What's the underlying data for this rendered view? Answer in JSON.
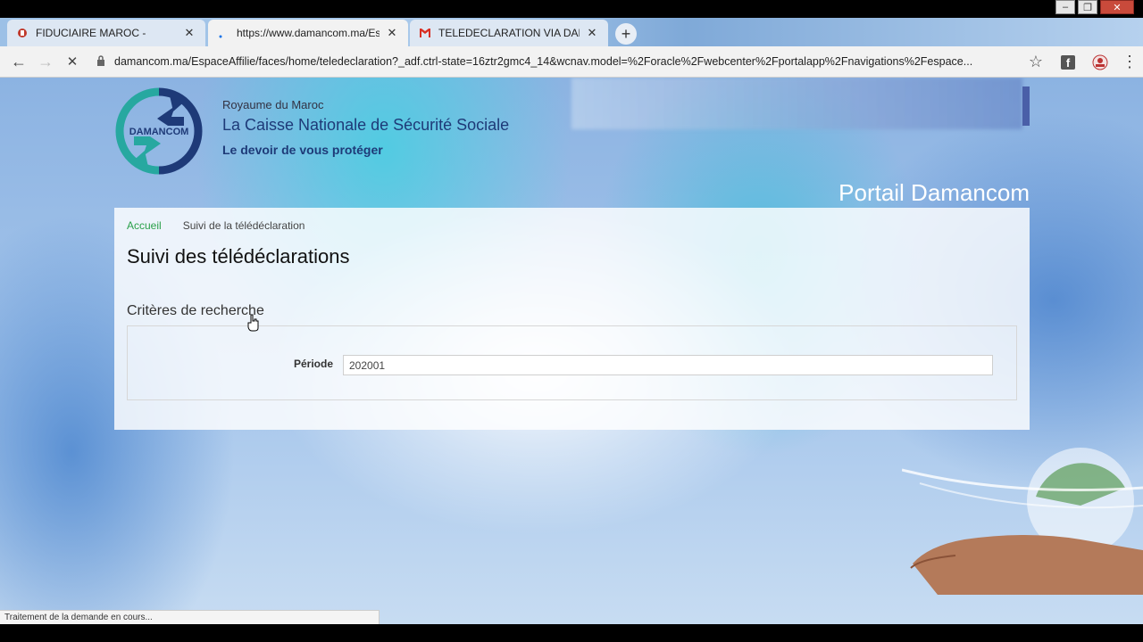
{
  "browser": {
    "tabs": [
      {
        "title": "FIDUCIAIRE MAROC -",
        "favicon": "document-icon"
      },
      {
        "title": "https://www.damancom.ma/Espa",
        "favicon": "loading-icon"
      },
      {
        "title": "TELEDECLARATION VIA DAMANC",
        "favicon": "gmail-icon"
      }
    ],
    "new_tab": "+",
    "window_controls": {
      "minimize": "–",
      "maximize": "❐",
      "close": "✕"
    },
    "nav": {
      "back": "←",
      "forward": "→",
      "stop": "✕"
    },
    "url": "damancom.ma/EspaceAffilie/faces/home/teledeclaration?_adf.ctrl-state=16ztr2gmc4_14&wcnav.model=%2Foracle%2Fwebcenter%2Fportalapp%2Fnavigations%2Fespace...",
    "bookmark": "☆",
    "menu": "⋮",
    "status_text": "Traitement de la demande en cours..."
  },
  "header": {
    "logo_text": "DAMANCOM",
    "country": "Royaume du Maroc",
    "org_name": "La Caisse Nationale de Sécurité Sociale",
    "motto": "Le devoir de vous protéger",
    "portal_title": "Portail Damancom"
  },
  "breadcrumb": {
    "home": "Accueil",
    "current": "Suivi de la télédéclaration"
  },
  "main": {
    "title": "Suivi des télédéclarations",
    "search_section": "Critères de recherche",
    "period_label": "Période",
    "period_value": "202001"
  },
  "colors": {
    "accent_green": "#2aa04a",
    "brand_navy": "#1e3a78",
    "logo_teal": "#27a8a0"
  }
}
